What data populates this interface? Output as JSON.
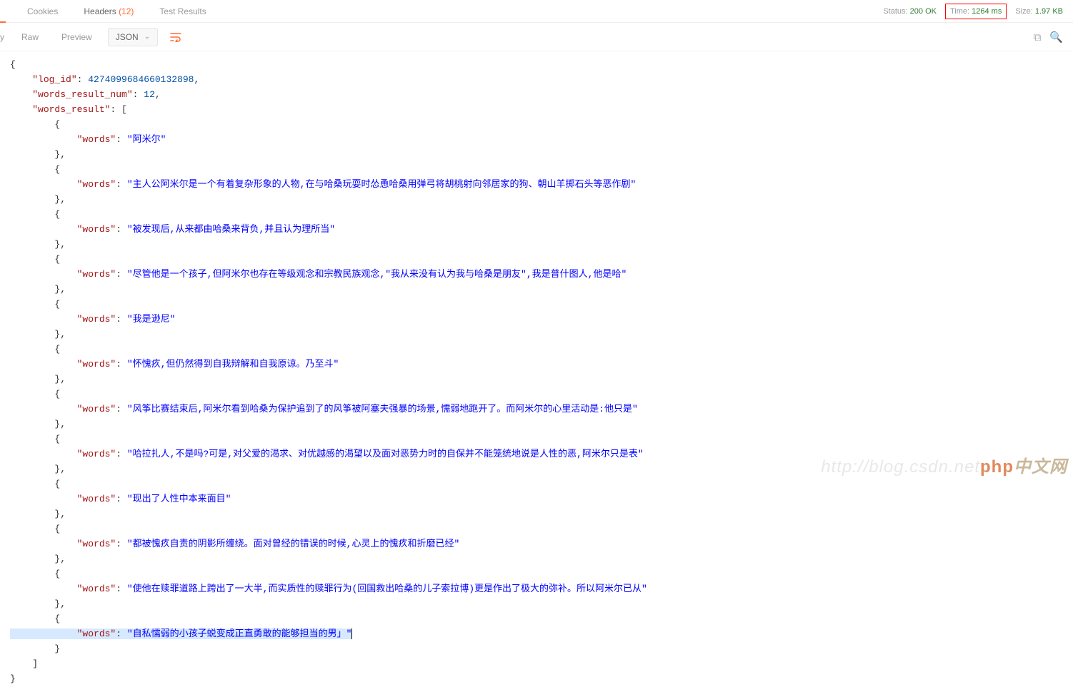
{
  "tabs": {
    "cookies": "Cookies",
    "headers": "Headers",
    "headers_count": "(12)",
    "tests": "Test Results"
  },
  "status": {
    "status_lbl": "Status:",
    "status_val": "200 OK",
    "time_lbl": "Time:",
    "time_val": "1264 ms",
    "size_lbl": "Size:",
    "size_val": "1.97 KB"
  },
  "sub": {
    "y": "y",
    "raw": "Raw",
    "preview": "Preview",
    "json": "JSON"
  },
  "json": {
    "log_id_key": "\"log_id\"",
    "log_id_val": "4274099684660132898",
    "num_key": "\"words_result_num\"",
    "num_val": "12",
    "result_key": "\"words_result\"",
    "words_key": "\"words\"",
    "items": [
      "\"阿米尔\"",
      "\"主人公阿米尔是一个有着复杂形象的人物,在与哈桑玩耍时怂恿哈桑用弹弓将胡桃射向邻居家的狗、朝山羊掷石头等恶作剧\"",
      "\"被发现后,从来都由哈桑来背负,并且认为理所当\"",
      "\"尽管他是一个孩子,但阿米尔也存在等级观念和宗教民族观念,\"我从来没有认为我与哈桑是朋友\",我是普什图人,他是哈\"",
      "\"我是逊尼\"",
      "\"怀愧疚,但仍然得到自我辩解和自我原谅。乃至斗\"",
      "\"风筝比赛结束后,阿米尔看到哈桑为保护追到了的风筝被阿塞夫强暴的场景,懦弱地跑开了。而阿米尔的心里活动是:他只是\"",
      "\"哈拉扎人,不是吗?可是,对父爱的渴求、对优越感的渴望以及面对恶势力时的自保并不能笼统地说是人性的恶,阿米尔只是表\"",
      "\"现出了人性中本来面目\"",
      "\"都被愧疚自责的阴影所缠绕。面对曾经的错误的时候,心灵上的愧疚和折磨已经\"",
      "\"使他在赎罪道路上跨出了一大半,而实质性的赎罪行为(回国救出哈桑的儿子索拉博)更是作出了极大的弥补。所以阿米尔已从\"",
      "\"自私懦弱的小孩子蜕变成正直勇敢的能够担当的男」\""
    ]
  },
  "watermark": {
    "url": "http://blog.csdn.net",
    "php": "php",
    "cn": "中文网"
  }
}
